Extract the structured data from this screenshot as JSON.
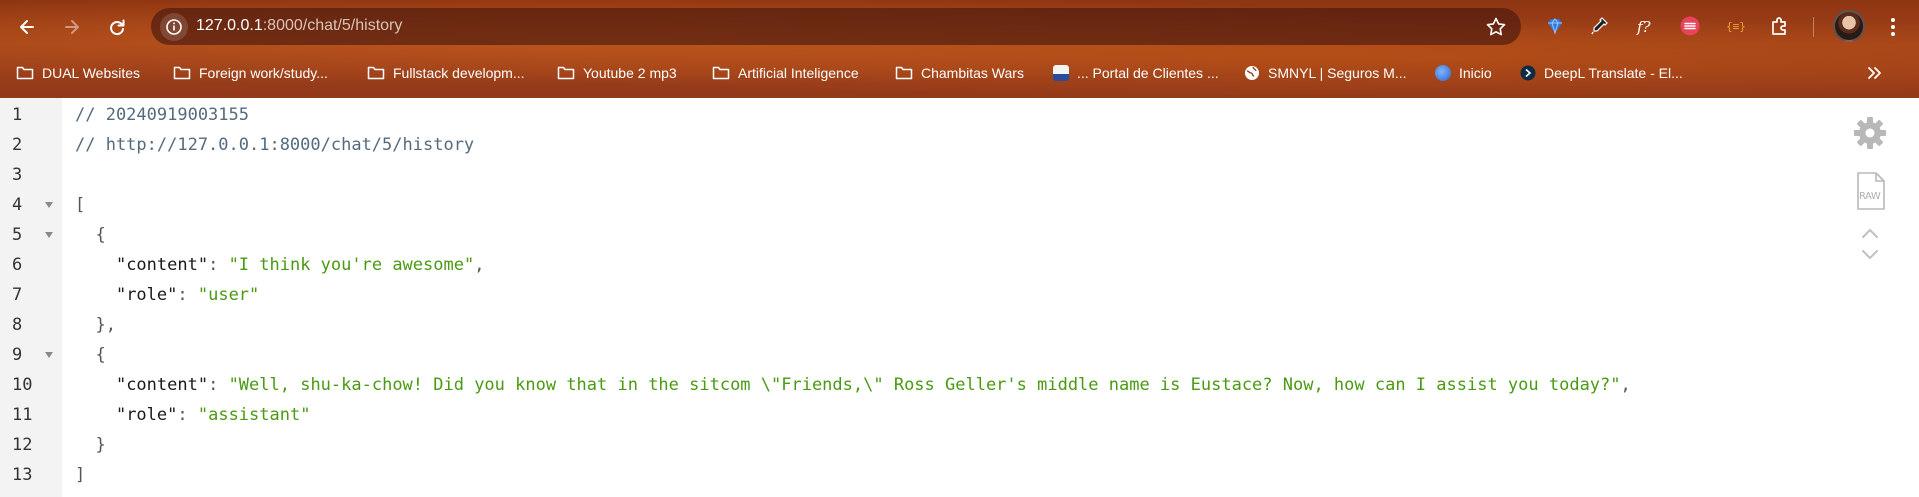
{
  "browser": {
    "url_host": "127.0.0.1",
    "url_rest": ":8000/chat/5/history",
    "bookmarks": [
      {
        "label": "DUAL Websites",
        "icon": "folder-icon"
      },
      {
        "label": "Foreign work/study...",
        "icon": "folder-icon"
      },
      {
        "label": "Fullstack developm...",
        "icon": "folder-icon"
      },
      {
        "label": "Youtube 2 mp3",
        "icon": "folder-icon"
      },
      {
        "label": "Artificial Inteligence",
        "icon": "folder-icon"
      },
      {
        "label": "Chambitas Wars",
        "icon": "folder-icon"
      },
      {
        "label": "... Portal de Clientes ...",
        "icon": "portal-favicon"
      },
      {
        "label": "SMNYL | Seguros M...",
        "icon": "globe-icon"
      },
      {
        "label": "Inicio",
        "icon": "inicio-favicon"
      },
      {
        "label": "DeepL Translate - El...",
        "icon": "deepl-favicon"
      }
    ]
  },
  "viewer": {
    "lines": [
      {
        "n": "1",
        "fold": false,
        "indent": "",
        "tokens": [
          {
            "t": "comment",
            "v": "// 20240919003155"
          }
        ]
      },
      {
        "n": "2",
        "fold": false,
        "indent": "",
        "tokens": [
          {
            "t": "comment",
            "v": "// http://127.0.0.1:8000/chat/5/history"
          }
        ]
      },
      {
        "n": "3",
        "fold": false,
        "indent": "",
        "tokens": []
      },
      {
        "n": "4",
        "fold": true,
        "indent": "",
        "tokens": [
          {
            "t": "punc",
            "v": "["
          }
        ]
      },
      {
        "n": "5",
        "fold": true,
        "indent": "  ",
        "tokens": [
          {
            "t": "punc",
            "v": "{"
          }
        ]
      },
      {
        "n": "6",
        "fold": false,
        "indent": "    ",
        "tokens": [
          {
            "t": "key",
            "v": "\"content\""
          },
          {
            "t": "punc",
            "v": ": "
          },
          {
            "t": "str",
            "v": "\"I think you're awesome\""
          },
          {
            "t": "punc",
            "v": ","
          }
        ]
      },
      {
        "n": "7",
        "fold": false,
        "indent": "    ",
        "tokens": [
          {
            "t": "key",
            "v": "\"role\""
          },
          {
            "t": "punc",
            "v": ": "
          },
          {
            "t": "str",
            "v": "\"user\""
          }
        ]
      },
      {
        "n": "8",
        "fold": false,
        "indent": "  ",
        "tokens": [
          {
            "t": "punc",
            "v": "},"
          }
        ]
      },
      {
        "n": "9",
        "fold": true,
        "indent": "  ",
        "tokens": [
          {
            "t": "punc",
            "v": "{"
          }
        ]
      },
      {
        "n": "10",
        "fold": false,
        "indent": "    ",
        "tokens": [
          {
            "t": "key",
            "v": "\"content\""
          },
          {
            "t": "punc",
            "v": ": "
          },
          {
            "t": "str",
            "v": "\"Well, shu-ka-chow! Did you know that in the sitcom \\\"Friends,\\\" Ross Geller's middle name is Eustace? Now, how can I assist you today?\""
          },
          {
            "t": "punc",
            "v": ","
          }
        ]
      },
      {
        "n": "11",
        "fold": false,
        "indent": "    ",
        "tokens": [
          {
            "t": "key",
            "v": "\"role\""
          },
          {
            "t": "punc",
            "v": ": "
          },
          {
            "t": "str",
            "v": "\"assistant\""
          }
        ]
      },
      {
        "n": "12",
        "fold": false,
        "indent": "  ",
        "tokens": [
          {
            "t": "punc",
            "v": "}"
          }
        ]
      },
      {
        "n": "13",
        "fold": false,
        "indent": "",
        "tokens": [
          {
            "t": "punc",
            "v": "]"
          }
        ]
      }
    ],
    "raw_label": "RAW"
  }
}
